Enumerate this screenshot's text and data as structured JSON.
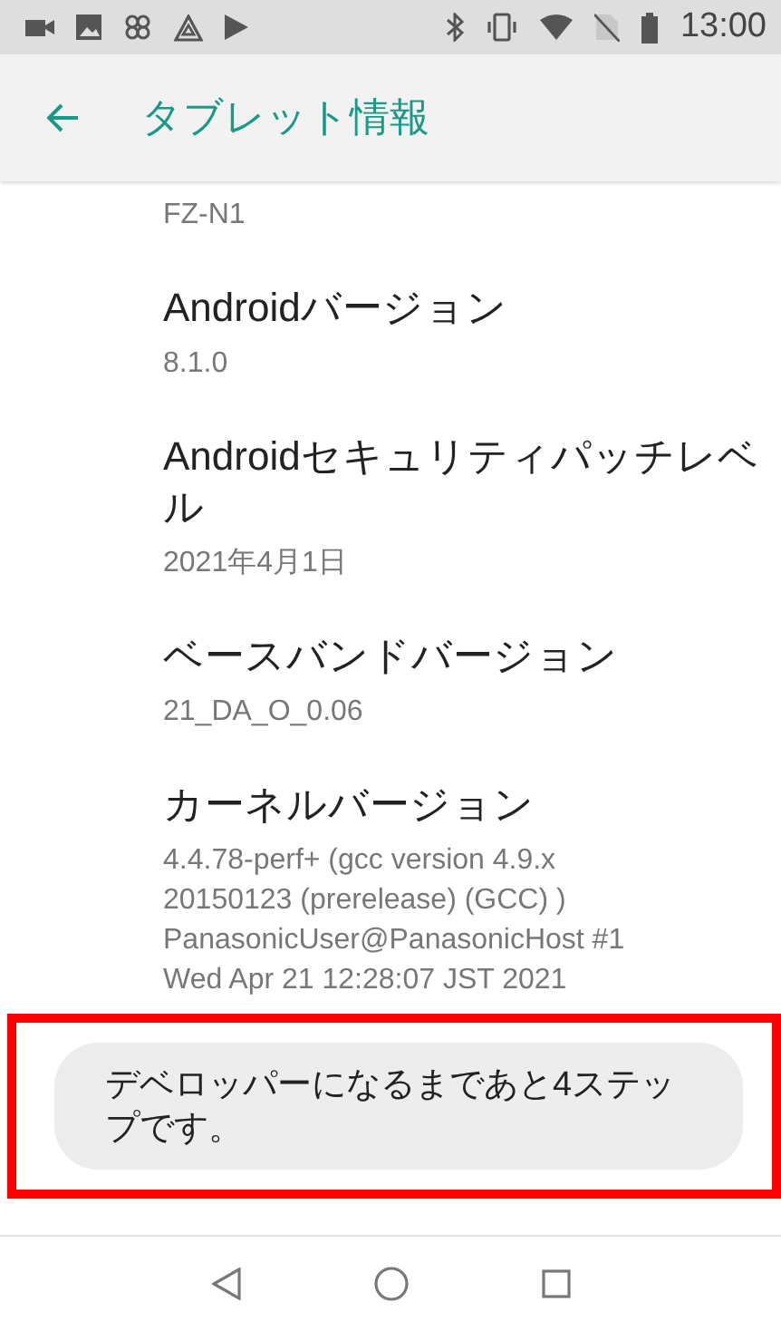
{
  "status_bar": {
    "time": "13:00"
  },
  "app_bar": {
    "title": "タブレット情報"
  },
  "items": [
    {
      "value_lines": [
        "FZ-N1"
      ]
    },
    {
      "title": "Androidバージョン",
      "value_lines": [
        "8.1.0"
      ]
    },
    {
      "title": "Androidセキュリティパッチレベル",
      "value_lines": [
        "2021年4月1日"
      ]
    },
    {
      "title": "ベースバンドバージョン",
      "value_lines": [
        "21_DA_O_0.06"
      ]
    },
    {
      "title": "カーネルバージョン",
      "value_lines": [
        "4.4.78-perf+ (gcc version 4.9.x",
        "20150123 (prerelease) (GCC) )",
        "PanasonicUser@PanasonicHost #1",
        "Wed Apr 21 12:28:07 JST 2021"
      ]
    }
  ],
  "toast": {
    "message": "デベロッパーになるまであと4ステップです。"
  }
}
